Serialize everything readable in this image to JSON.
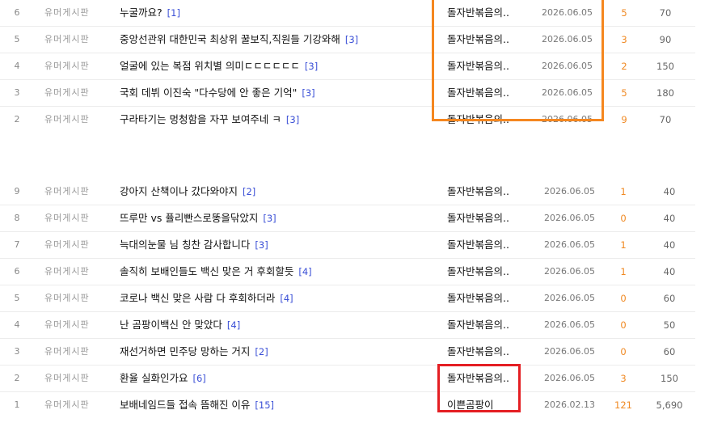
{
  "posts_top": [
    {
      "num": "6",
      "board": "유머게시판",
      "title": "누굴까요?",
      "comments": "[1]",
      "author": "돌자반볶음의..",
      "date": "2026.06.05",
      "recommend": "5",
      "views": "70"
    },
    {
      "num": "5",
      "board": "유머게시판",
      "title": "중앙선관위 대한민국 최상위 꿀보직,직원들 기강와해",
      "comments": "[3]",
      "author": "돌자반볶음의..",
      "date": "2026.06.05",
      "recommend": "3",
      "views": "90"
    },
    {
      "num": "4",
      "board": "유머게시판",
      "title": "얼굴에 있는 복점 위치별 의미ㄷㄷㄷㄷㄷㄷ",
      "comments": "[3]",
      "author": "돌자반볶음의..",
      "date": "2026.06.05",
      "recommend": "2",
      "views": "150"
    },
    {
      "num": "3",
      "board": "유머게시판",
      "title": "국회 데뷔 이진숙 \"다수당에 안 좋은 기억\"",
      "comments": "[3]",
      "author": "돌자반볶음의..",
      "date": "2026.06.05",
      "recommend": "5",
      "views": "180"
    },
    {
      "num": "2",
      "board": "유머게시판",
      "title": "구라타기는 멍청함을 자꾸 보여주네 ㅋ",
      "comments": "[3]",
      "author": "돌자반볶음의..",
      "date": "2026.06.05",
      "recommend": "9",
      "views": "70"
    }
  ],
  "posts_bottom": [
    {
      "num": "9",
      "board": "유머게시판",
      "title": "강아지 산책이나 갔다와야지",
      "comments": "[2]",
      "author": "돌자반볶음의..",
      "date": "2026.06.05",
      "recommend": "1",
      "views": "40"
    },
    {
      "num": "8",
      "board": "유머게시판",
      "title": "뜨루만 vs 퓰리빤스로똥을닦았지",
      "comments": "[3]",
      "author": "돌자반볶음의..",
      "date": "2026.06.05",
      "recommend": "0",
      "views": "40"
    },
    {
      "num": "7",
      "board": "유머게시판",
      "title": "늑대의눈물 님 칭찬 감사합니다",
      "comments": "[3]",
      "author": "돌자반볶음의..",
      "date": "2026.06.05",
      "recommend": "1",
      "views": "40"
    },
    {
      "num": "6",
      "board": "유머게시판",
      "title": "솔직히 보배인들도 백신 맞은 거 후회할듯",
      "comments": "[4]",
      "author": "돌자반볶음의..",
      "date": "2026.06.05",
      "recommend": "1",
      "views": "40"
    },
    {
      "num": "5",
      "board": "유머게시판",
      "title": "코로나 백신 맞은 사람 다 후회하더라",
      "comments": "[4]",
      "author": "돌자반볶음의..",
      "date": "2026.06.05",
      "recommend": "0",
      "views": "60"
    },
    {
      "num": "4",
      "board": "유머게시판",
      "title": "난 곰팡이백신 안 맞았다",
      "comments": "[4]",
      "author": "돌자반볶음의..",
      "date": "2026.06.05",
      "recommend": "0",
      "views": "50"
    },
    {
      "num": "3",
      "board": "유머게시판",
      "title": "재선거하면 민주당 망하는 거지",
      "comments": "[2]",
      "author": "돌자반볶음의..",
      "date": "2026.06.05",
      "recommend": "0",
      "views": "60"
    },
    {
      "num": "2",
      "board": "유머게시판",
      "title": "환율 실화인가요",
      "comments": "[6]",
      "author": "돌자반볶음의..",
      "date": "2026.06.05",
      "recommend": "3",
      "views": "150"
    },
    {
      "num": "1",
      "board": "유머게시판",
      "title": "보배네임드들 접속 뜸해진 이유",
      "comments": "[15]",
      "author": "이쁜곰팡이",
      "date": "2026.02.13",
      "recommend": "121",
      "views": "5,690"
    }
  ],
  "colors": {
    "orange_highlight": "#f5871f",
    "red_highlight": "#e41e23",
    "comment_count": "#3a4fd6",
    "recommend": "#f08a24"
  }
}
